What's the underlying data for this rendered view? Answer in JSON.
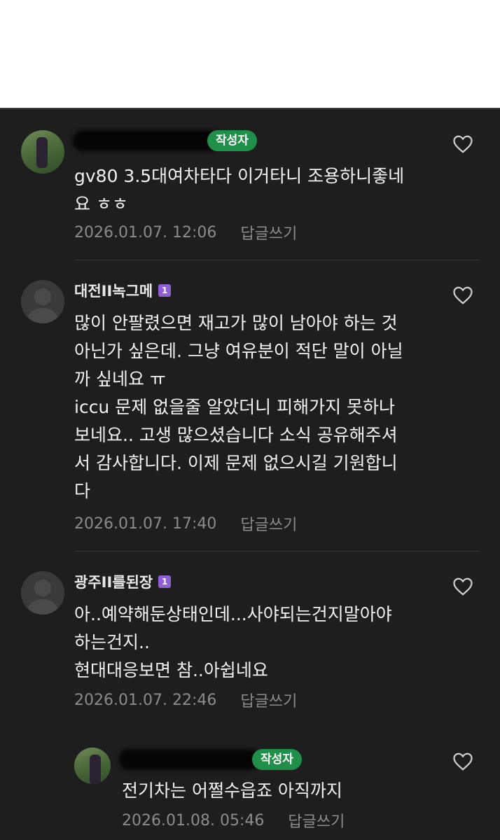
{
  "comments": [
    {
      "nickname": "",
      "author_badge": "작성자",
      "text": "gv80 3.5대여차타다 이거타니 조용하니좋네\n요 ㅎㅎ",
      "date": "2026.01.07. 12:06",
      "reply_label": "답글쓰기"
    },
    {
      "nickname": "대전II녹그메",
      "level": "1",
      "text": "많이 안팔렸으면 재고가 많이 남아야 하는 것\n아닌가 싶은데. 그냥 여유분이 적단 말이 아닐\n까 싶네요 ㅠ\niccu 문제 없을줄 알았더니 피해가지 못하나\n보네요.. 고생 많으셨습니다 소식 공유해주셔\n서 감사합니다. 이제 문제 없으시길 기원합니\n다",
      "date": "2026.01.07. 17:40",
      "reply_label": "답글쓰기"
    },
    {
      "nickname": "광주II를된장",
      "level": "1",
      "text": "아..예약해둔상태인데...사야되는건지말아야\n하는건지..\n현대대응보면 참..아쉽네요",
      "date": "2026.01.07. 22:46",
      "reply_label": "답글쓰기"
    },
    {
      "nickname": "",
      "author_badge": "작성자",
      "text": "전기차는 어쩔수읍죠 아직까지",
      "date": "2026.01.08. 05:46",
      "reply_label": "답글쓰기"
    }
  ],
  "icons": {
    "like": "heart-outline-icon"
  },
  "colors": {
    "background": "#1e1e1e",
    "text": "#f2f2f2",
    "meta": "#8c8c8c",
    "author_badge": "#1f8f4a",
    "level_badge": "#8f5fd6"
  }
}
